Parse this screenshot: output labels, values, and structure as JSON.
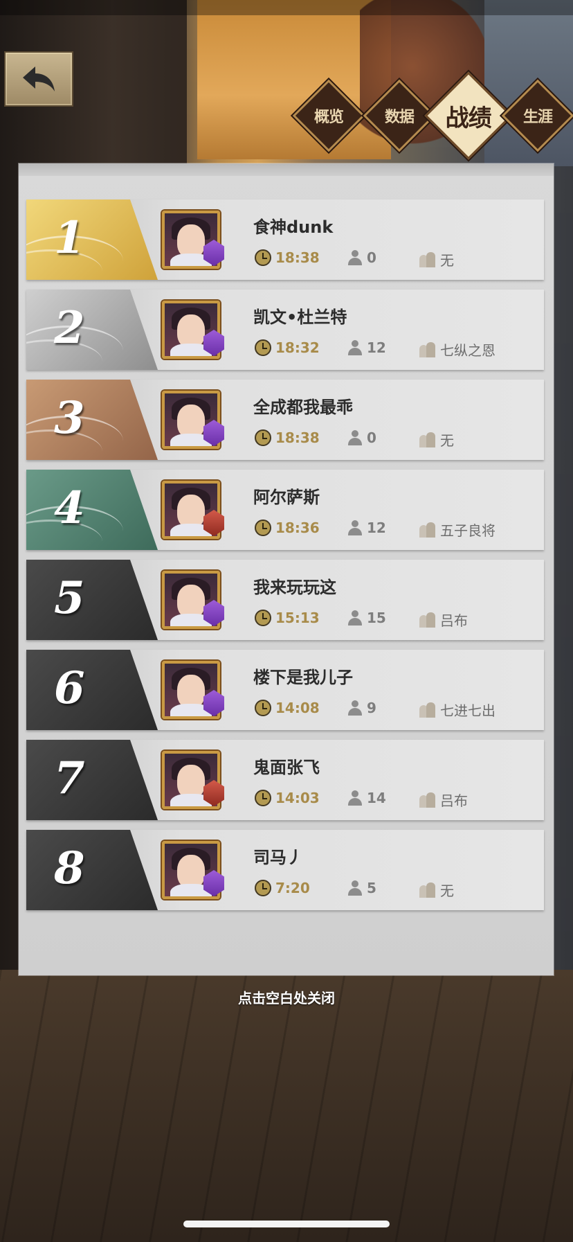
{
  "tabs": [
    {
      "label": "概览",
      "active": false
    },
    {
      "label": "数据",
      "active": false
    },
    {
      "label": "战绩",
      "active": true
    },
    {
      "label": "生涯",
      "active": false
    }
  ],
  "rows": [
    {
      "rank": "1",
      "name": "食神dunk",
      "time": "18:38",
      "count": "0",
      "title": "无"
    },
    {
      "rank": "2",
      "name": "凯文•杜兰特",
      "time": "18:32",
      "count": "12",
      "title": "七纵之恩"
    },
    {
      "rank": "3",
      "name": "全成都我最乖",
      "time": "18:38",
      "count": "0",
      "title": "无"
    },
    {
      "rank": "4",
      "name": "阿尔萨斯",
      "time": "18:36",
      "count": "12",
      "title": "五子良将"
    },
    {
      "rank": "5",
      "name": "我来玩玩这",
      "time": "15:13",
      "count": "15",
      "title": "吕布"
    },
    {
      "rank": "6",
      "name": "楼下是我儿子",
      "time": "14:08",
      "count": "9",
      "title": "七进七出"
    },
    {
      "rank": "7",
      "name": "鬼面张飞",
      "time": "14:03",
      "count": "14",
      "title": "吕布"
    },
    {
      "rank": "8",
      "name": "司马丿",
      "time": "7:20",
      "count": "5",
      "title": "无"
    }
  ],
  "close_hint": "点击空白处关闭",
  "colors": {
    "gold": "#cfa23a",
    "silver": "#a0a0a0",
    "bronze": "#a8755a",
    "green": "#4f7e6c",
    "dark": "#333333",
    "time_text": "#a88b4a"
  }
}
